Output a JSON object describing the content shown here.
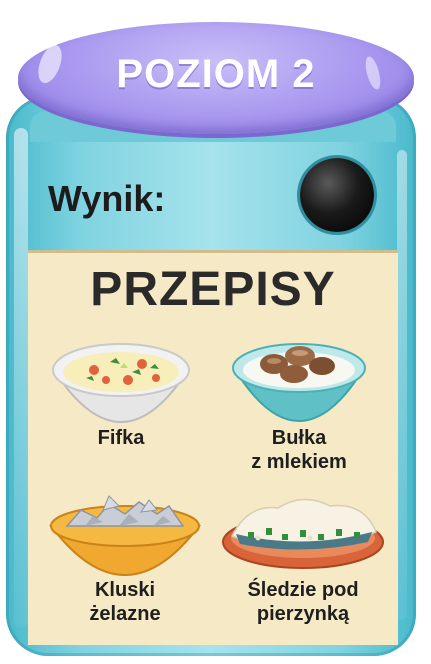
{
  "level": {
    "title": "POZIOM 2"
  },
  "score": {
    "label": "Wynik:",
    "indicator_color": "#111111"
  },
  "recipes_panel": {
    "title": "PRZEPISY",
    "items": [
      {
        "label_lines": [
          "Fifka"
        ],
        "icon": "soup-bowl-icon"
      },
      {
        "label_lines": [
          "Bułka",
          "z mlekiem"
        ],
        "icon": "bun-milk-bowl-icon"
      },
      {
        "label_lines": [
          "Kluski",
          "żelazne"
        ],
        "icon": "dumplings-bowl-icon"
      },
      {
        "label_lines": [
          "Śledzie pod",
          "pierzynką"
        ],
        "icon": "herring-dish-icon"
      }
    ]
  },
  "colors": {
    "jar": "#7fd3e0",
    "lid": "#a897ef",
    "panel": "#f6e9c6"
  }
}
